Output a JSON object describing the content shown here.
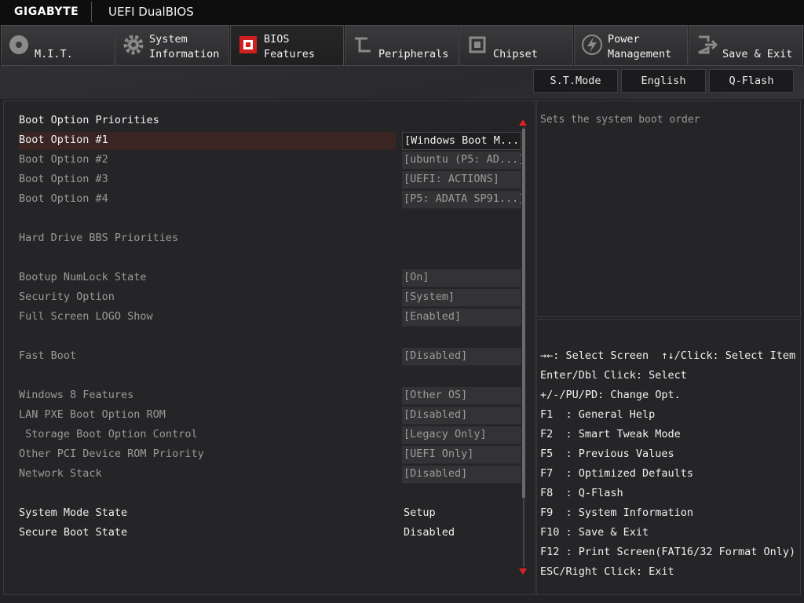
{
  "header": {
    "brand": "GIGABYTE",
    "product": "UEFI DualBIOS"
  },
  "tabs": [
    {
      "line1": "",
      "line2": "M.I.T.",
      "icon": "disc-icon"
    },
    {
      "line1": "System",
      "line2": "Information",
      "icon": "gear-icon"
    },
    {
      "line1": "BIOS",
      "line2": "Features",
      "icon": "bios-chip-icon",
      "active": true
    },
    {
      "line1": "",
      "line2": "Peripherals",
      "icon": "plug-icon"
    },
    {
      "line1": "",
      "line2": "Chipset",
      "icon": "chip-icon"
    },
    {
      "line1": "Power",
      "line2": "Management",
      "icon": "lightning-icon"
    },
    {
      "line1": "",
      "line2": "Save & Exit",
      "icon": "exit-icon"
    }
  ],
  "toolbar": {
    "st_mode": "S.T.Mode",
    "language": "English",
    "qflash": "Q-Flash"
  },
  "settings": {
    "boot_priorities_title": "Boot Option Priorities",
    "boot_options": [
      {
        "label": "Boot Option #1",
        "value": "[Windows Boot M...]"
      },
      {
        "label": "Boot Option #2",
        "value": "[ubuntu (P5: AD...]"
      },
      {
        "label": "Boot Option #3",
        "value": "[UEFI: ACTIONS]"
      },
      {
        "label": "Boot Option #4",
        "value": "[P5: ADATA SP91...]"
      }
    ],
    "hdd_bbs": "Hard Drive BBS Priorities",
    "numlock": {
      "label": "Bootup NumLock State",
      "value": "[On]"
    },
    "security": {
      "label": "Security Option",
      "value": "[System]"
    },
    "logo": {
      "label": "Full Screen LOGO Show",
      "value": "[Enabled]"
    },
    "fast_boot": {
      "label": "Fast Boot",
      "value": "[Disabled]"
    },
    "win8": {
      "label": "Windows 8 Features",
      "value": "[Other OS]"
    },
    "lan_pxe": {
      "label": "LAN PXE Boot Option ROM",
      "value": "[Disabled]"
    },
    "storage": {
      "label": " Storage Boot Option Control",
      "value": "[Legacy Only]"
    },
    "other_pci": {
      "label": "Other PCI Device ROM Priority",
      "value": "[UEFI Only]"
    },
    "network": {
      "label": "Network Stack",
      "value": "[Disabled]"
    },
    "system_mode": {
      "label": "System Mode State",
      "value": "Setup"
    },
    "secure_boot": {
      "label": "Secure Boot State",
      "value": "Disabled"
    }
  },
  "help": {
    "text": "Sets the system boot order"
  },
  "keys": [
    "→←: Select Screen  ↑↓/Click: Select Item",
    "Enter/Dbl Click: Select",
    "+/-/PU/PD: Change Opt.",
    "F1  : General Help",
    "F2  : Smart Tweak Mode",
    "F5  : Previous Values",
    "F7  : Optimized Defaults",
    "F8  : Q-Flash",
    "F9  : System Information",
    "F10 : Save & Exit",
    "F12 : Print Screen(FAT16/32 Format Only)",
    "ESC/Right Click: Exit"
  ],
  "colors": {
    "accent": "#cc2222",
    "selected_row": "#3a2522"
  }
}
